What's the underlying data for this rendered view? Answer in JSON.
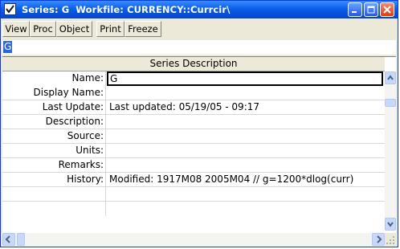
{
  "window": {
    "title": "Series: G",
    "workfile": "Workfile: CURRENCY::Currcir\\"
  },
  "toolbar": {
    "buttons": [
      "View",
      "Proc",
      "Object",
      "Print",
      "Freeze"
    ]
  },
  "command": {
    "value": "G"
  },
  "table": {
    "header": "Series Description",
    "rows": [
      {
        "label": "Name:",
        "value": "G"
      },
      {
        "label": "Display Name:",
        "value": ""
      },
      {
        "label": "Last Update:",
        "value": "Last updated: 05/19/05 - 09:17"
      },
      {
        "label": "Description:",
        "value": ""
      },
      {
        "label": "Source:",
        "value": ""
      },
      {
        "label": "Units:",
        "value": ""
      },
      {
        "label": "Remarks:",
        "value": ""
      },
      {
        "label": "History:",
        "value": "Modified: 1917M08 2005M04 // g=1200*dlog(curr)"
      },
      {
        "label": "",
        "value": ""
      },
      {
        "label": "",
        "value": ""
      }
    ]
  },
  "colors": {
    "titlebar": "#0a5ee8",
    "selection": "#2a6ad8",
    "close_button": "#d73e12"
  },
  "icons": {
    "app": "checkmark-window-icon",
    "minimize": "minimize-icon",
    "maximize": "maximize-icon",
    "close": "close-icon",
    "scroll_up": "chevron-up-icon",
    "scroll_down": "chevron-down-icon",
    "scroll_left": "chevron-left-icon",
    "scroll_right": "chevron-right-icon"
  }
}
